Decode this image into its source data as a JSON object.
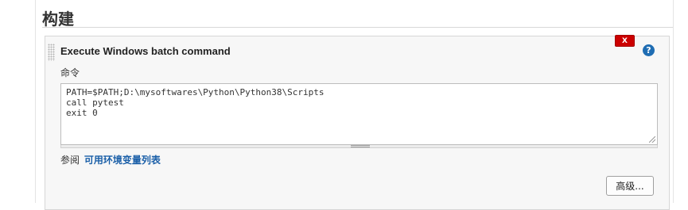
{
  "section": {
    "title": "构建"
  },
  "step": {
    "title": "Execute Windows batch command",
    "delete_label": "X",
    "help_label": "?",
    "command_label": "命令",
    "command_lines": [
      "PATH=$PATH;D:\\mysoftwares\\Python\\Python38\\Scripts",
      "call pytest",
      "exit 0"
    ],
    "env_prefix": "参阅",
    "env_link": "可用环境变量列表",
    "advanced_label": "高级..."
  },
  "colors": {
    "delete": "#cc0000",
    "help": "#1f6db3",
    "link": "#1a5fa8"
  },
  "icons": [
    "drag-handle-icon",
    "close-icon",
    "help-icon",
    "resize-grip-icon"
  ]
}
